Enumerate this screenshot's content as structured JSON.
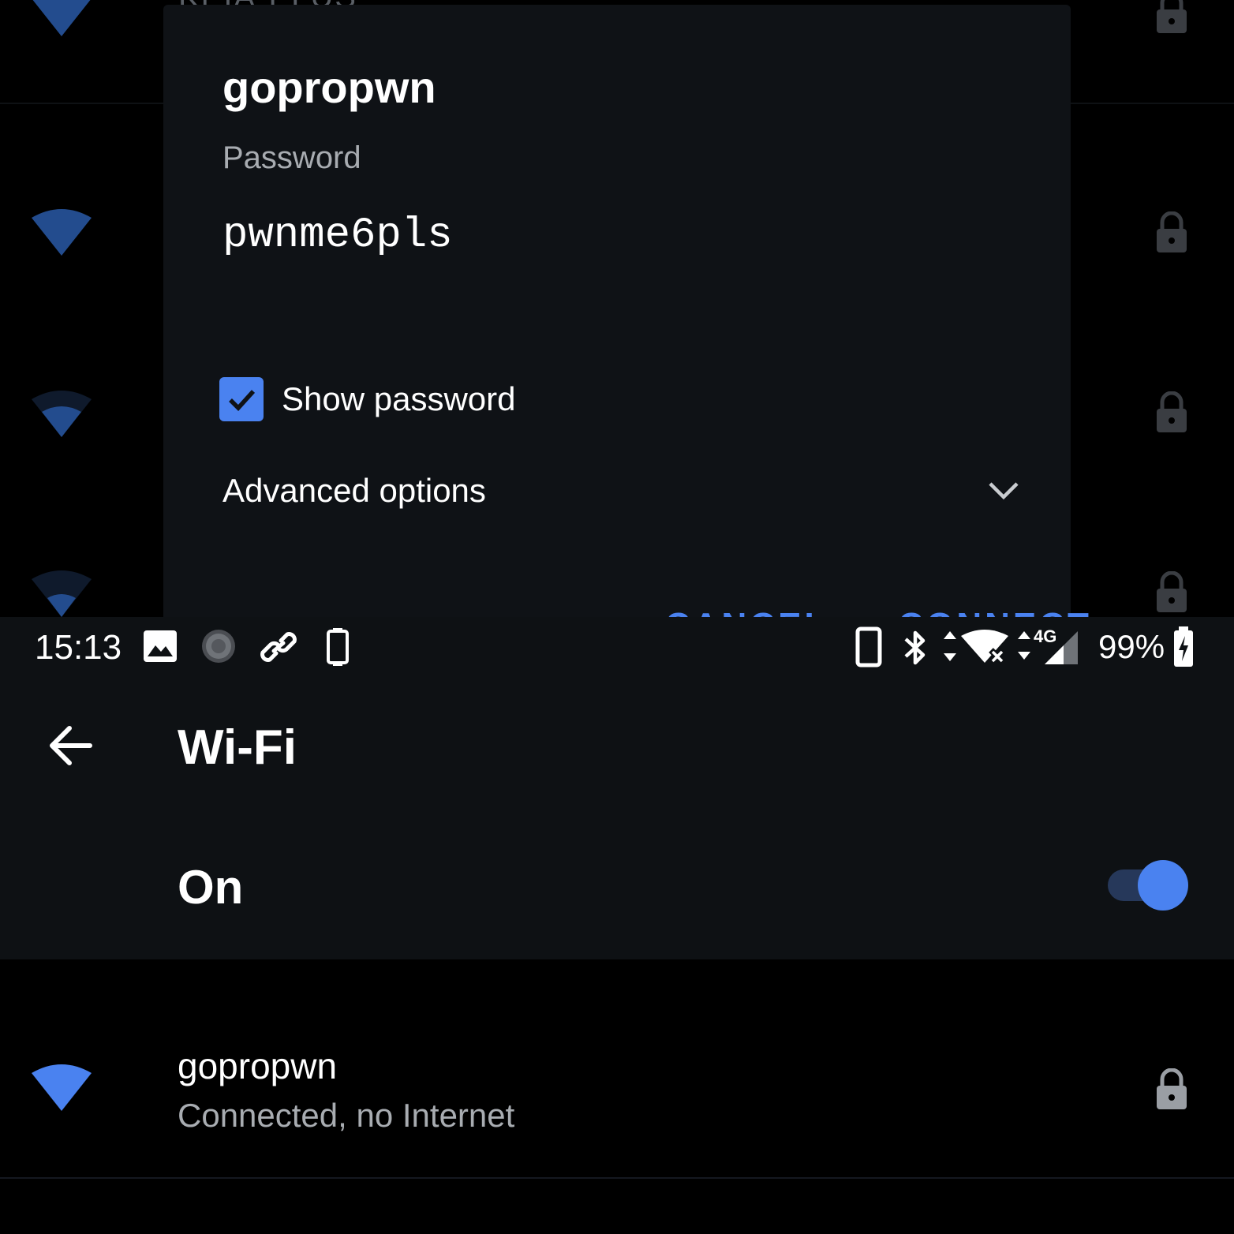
{
  "background_list": {
    "peek_text": "KEIA-PLUS"
  },
  "dialog": {
    "title": "gopropwn",
    "password_label": "Password",
    "password_value": "pwnme6pls",
    "show_password_label": "Show password",
    "show_password_checked": true,
    "advanced_options_label": "Advanced options",
    "cancel_label": "CANCEL",
    "connect_label": "CONNECT"
  },
  "status_bar": {
    "time": "15:13",
    "network_type": "4G",
    "battery": "99%",
    "left_icons": [
      "image-icon",
      "loading-circle-icon",
      "link-icon",
      "vibrate-icon"
    ],
    "right_icons": [
      "phone-icon",
      "bluetooth-icon",
      "wifi-data-icon",
      "cellular-signal-icon",
      "battery-charging-icon"
    ]
  },
  "app_bar": {
    "title": "Wi-Fi"
  },
  "wifi_toggle": {
    "label": "On",
    "enabled": true
  },
  "networks": [
    {
      "name": "gopropwn",
      "status": "Connected, no Internet",
      "secured": true
    }
  ],
  "colors": {
    "accent": "#4a82f0",
    "surface": "#0e1114",
    "dialog": "#0f1216",
    "secondary_text": "#a8acb1"
  }
}
